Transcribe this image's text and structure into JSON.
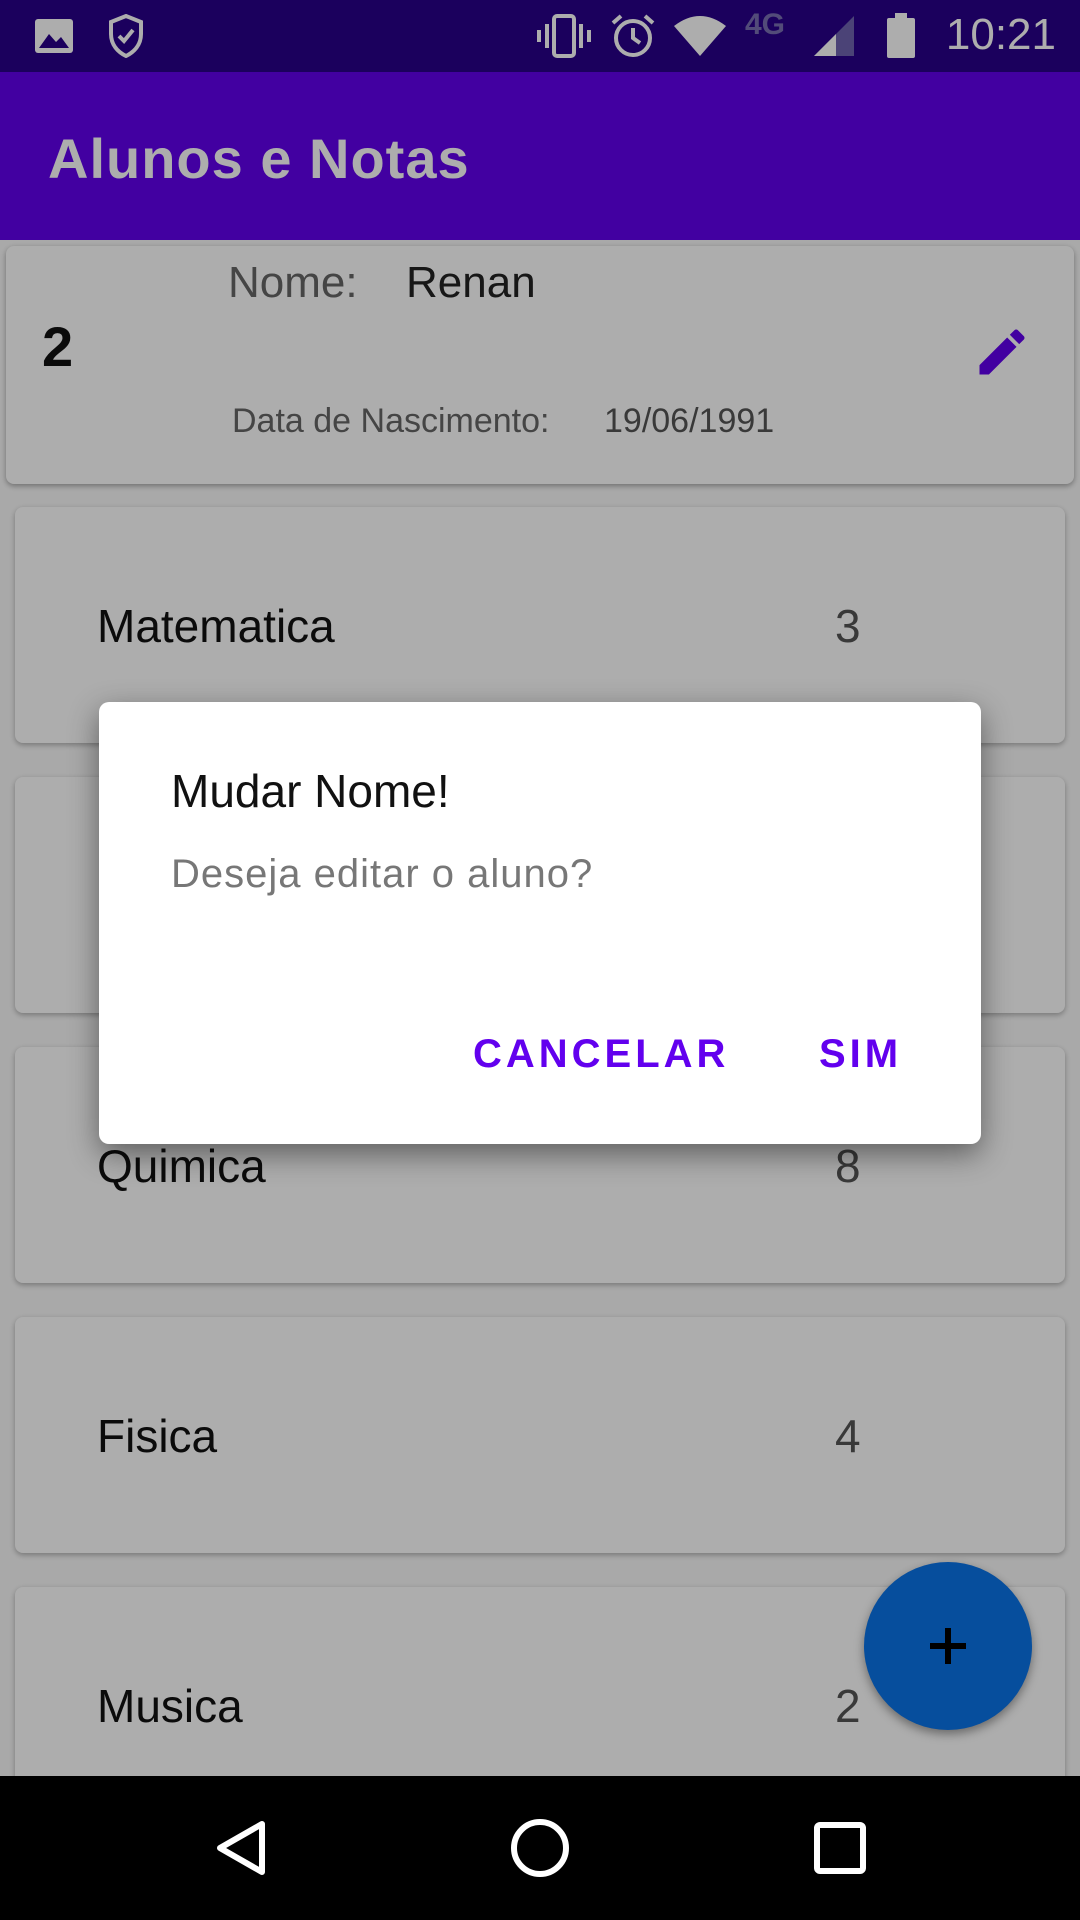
{
  "status_bar": {
    "time": "10:21",
    "network": "4G",
    "icons": [
      "image-icon",
      "shield-check-icon",
      "vibrate-icon",
      "alarm-icon",
      "wifi-icon",
      "signal-icon",
      "battery-icon"
    ]
  },
  "app_bar": {
    "title": "Alunos e Notas"
  },
  "student": {
    "id": "2",
    "name_label": "Nome:",
    "name": "Renan",
    "dob_label": "Data de Nascimento:",
    "dob": "19/06/1991"
  },
  "grades": [
    {
      "subject": "Matematica",
      "grade": "3"
    },
    {
      "subject": "",
      "grade": ""
    },
    {
      "subject": "Quimica",
      "grade": "8"
    },
    {
      "subject": "Fisica",
      "grade": "4"
    },
    {
      "subject": "Musica",
      "grade": "2"
    }
  ],
  "dialog": {
    "title": "Mudar Nome!",
    "message": "Deseja editar o aluno?",
    "cancel_label": "CANCELAR",
    "ok_label": "SIM"
  },
  "colors": {
    "primary": "#6200ee",
    "status_bar": "#29008a",
    "fab": "#0a73e8",
    "accent_text": "#6200ee"
  }
}
